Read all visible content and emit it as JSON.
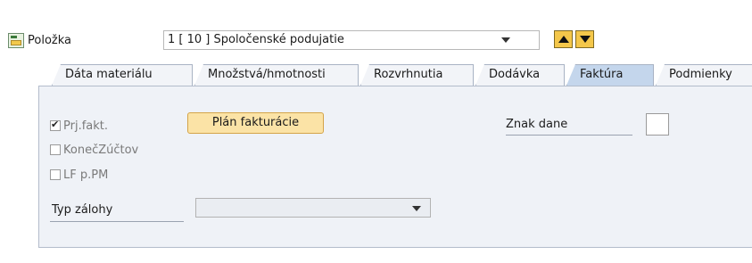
{
  "item": {
    "label": "Položka",
    "value": "1 [ 10 ] Spoločenské podujatie"
  },
  "tabs": [
    {
      "label": "Dáta materiálu",
      "active": false
    },
    {
      "label": "Množstvá/hmotnosti",
      "active": false
    },
    {
      "label": "Rozvrhnutia",
      "active": false
    },
    {
      "label": "Dodávka",
      "active": false
    },
    {
      "label": "Faktúra",
      "active": true
    },
    {
      "label": "Podmienky",
      "active": false
    }
  ],
  "invoice": {
    "checkboxes": [
      {
        "label": "Prj.fakt.",
        "checked": true
      },
      {
        "label": "KonečZúčtov",
        "checked": false
      },
      {
        "label": "LF p.PM",
        "checked": false
      }
    ],
    "plan_button_label": "Plán fakturácie",
    "tax_code_label": "Znak dane",
    "tax_code_value": "",
    "down_payment_label": "Typ zálohy",
    "down_payment_value": ""
  },
  "icons": [
    "item-detail-icon",
    "chevron-down-icon",
    "arrow-up-icon",
    "arrow-down-icon",
    "checkmark-icon"
  ]
}
